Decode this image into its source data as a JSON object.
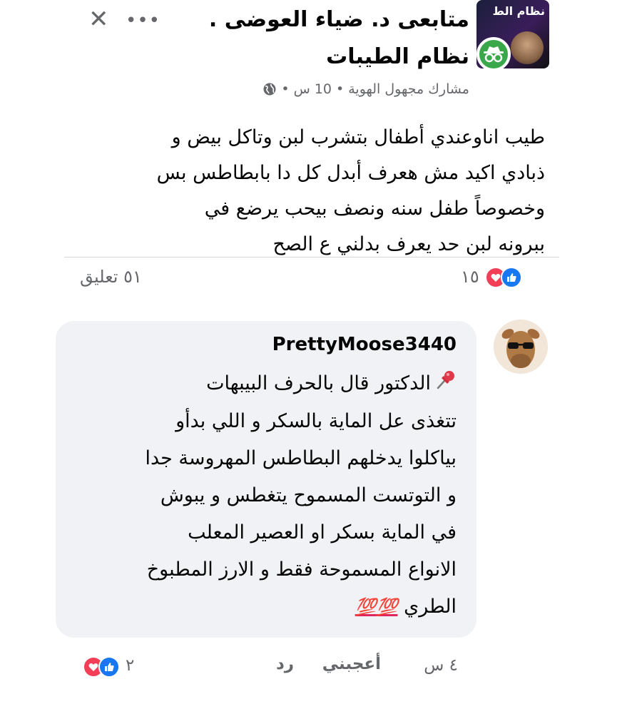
{
  "post": {
    "group_thumb_text": "نظام الط",
    "title_line1": "متابعى د. ضياء العوضى .",
    "title_line2": "نظام الطيبات",
    "meta_author": "مشارك مجهول الهوية",
    "meta_sep1": "•",
    "meta_time": "10 س",
    "meta_sep2": "•",
    "body": "طيب اناوعندي أطفال بتشرب لبن وتاكل بيض و\nذبادي اكيد مش هعرف أبدل كل دا بابطاطس بس\nوخصوصاً طفل سنه ونصف بيحب يرضع في\nببرونه لبن حد يعرف بدلني ع الصح",
    "reaction_count": "١٥",
    "comment_count": "٥١ تعليق",
    "more_icon": "more-horizontal-icon",
    "close_icon": "close-icon"
  },
  "comment": {
    "author": "PrettyMoose3440",
    "lines": [
      "الدكتور قال بالحرف البيبهات",
      "تتغذى عل الماية بالسكر و اللي بدأو",
      "بياكلوا يدخلهم البطاطس المهروسة جدا",
      "و التوتست المسموح يتغطس و يبوش",
      "في الماية بسكر او العصير المعلب",
      "الانواع المسموحة فقط و الارز المطبوخ",
      "الطري"
    ],
    "emoji_100": "💯",
    "time": "٤ س",
    "like_label": "أعجبني",
    "reply_label": "رد",
    "reaction_count": "٢"
  },
  "colors": {
    "like_blue": "#1877f2",
    "love_red": "#f33e58",
    "anon_green": "#3aa84a",
    "muted_text": "#65676b",
    "bubble_bg": "#f0f2f5"
  }
}
